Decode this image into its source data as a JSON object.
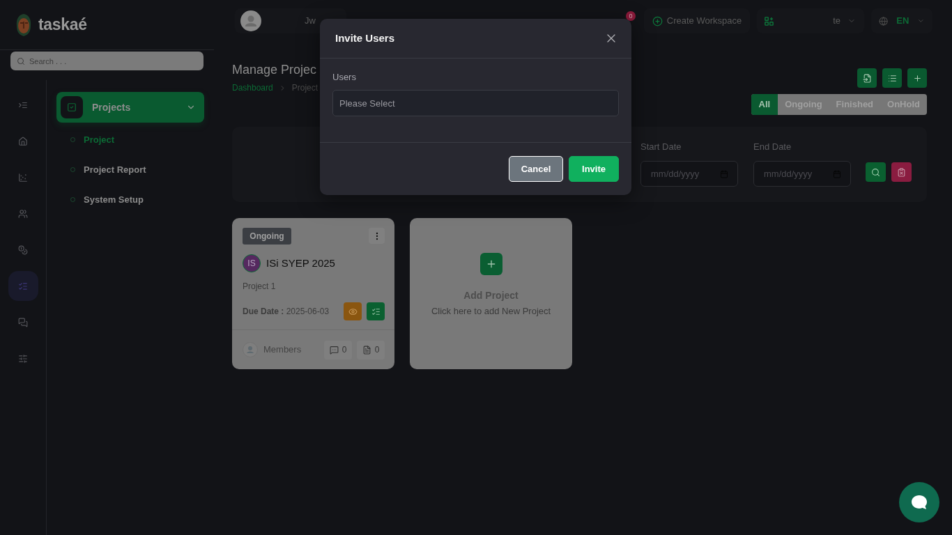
{
  "brand": {
    "name": "taskaé"
  },
  "search": {
    "placeholder": "Search . . ."
  },
  "rail": [
    {
      "kind": "indent",
      "selected": false
    },
    {
      "kind": "home",
      "selected": false
    },
    {
      "kind": "chart",
      "selected": false
    },
    {
      "kind": "users",
      "selected": false
    },
    {
      "kind": "finance",
      "selected": false
    },
    {
      "kind": "tasks",
      "selected": true
    },
    {
      "kind": "chat",
      "selected": false
    },
    {
      "kind": "settings",
      "selected": false
    }
  ],
  "menu": {
    "label": "Projects",
    "expanded": true,
    "items": [
      {
        "label": "Project",
        "selected": true
      },
      {
        "label": "Project Report",
        "selected": false
      },
      {
        "label": "System Setup",
        "selected": false
      }
    ]
  },
  "header": {
    "user": {
      "name": "Jw"
    },
    "notifications": {
      "count": "0"
    },
    "create_workspace": {
      "label": "Create Workspace"
    },
    "workspace": {
      "name": "te"
    },
    "language": {
      "code": "EN"
    }
  },
  "page": {
    "title": "Manage Projec",
    "breadcrumb": [
      {
        "label": "Dashboard",
        "kind": "link"
      },
      {
        "label": "Project",
        "kind": "current"
      }
    ],
    "toolbar": [
      {
        "kind": "import"
      },
      {
        "kind": "list"
      },
      {
        "kind": "add"
      }
    ]
  },
  "filters": {
    "tabs": [
      {
        "label": "All",
        "selected": true
      },
      {
        "label": "Ongoing",
        "selected": false
      },
      {
        "label": "Finished",
        "selected": false
      },
      {
        "label": "OnHold",
        "selected": false
      }
    ],
    "start_date": {
      "label": "Start Date",
      "placeholder": "mm/dd/yyyy"
    },
    "end_date": {
      "label": "End Date",
      "placeholder": "mm/dd/yyyy"
    }
  },
  "projects": [
    {
      "status": "Ongoing",
      "initials": "IS",
      "name": "ISi SYEP 2025",
      "description": "Project 1",
      "due": "**Due Date :** 2025-06-03",
      "members_label": "Members",
      "comments": "0",
      "files": "0"
    }
  ],
  "add_card": {
    "title": "Add Project",
    "subtitle": "Click here to add New Project"
  },
  "modal": {
    "title": "Invite Users",
    "field": {
      "label": "Users",
      "placeholder": "Please Select"
    },
    "buttons": [
      {
        "label": "Cancel",
        "kind": "secondary"
      },
      {
        "label": "Invite",
        "kind": "primary"
      }
    ]
  }
}
